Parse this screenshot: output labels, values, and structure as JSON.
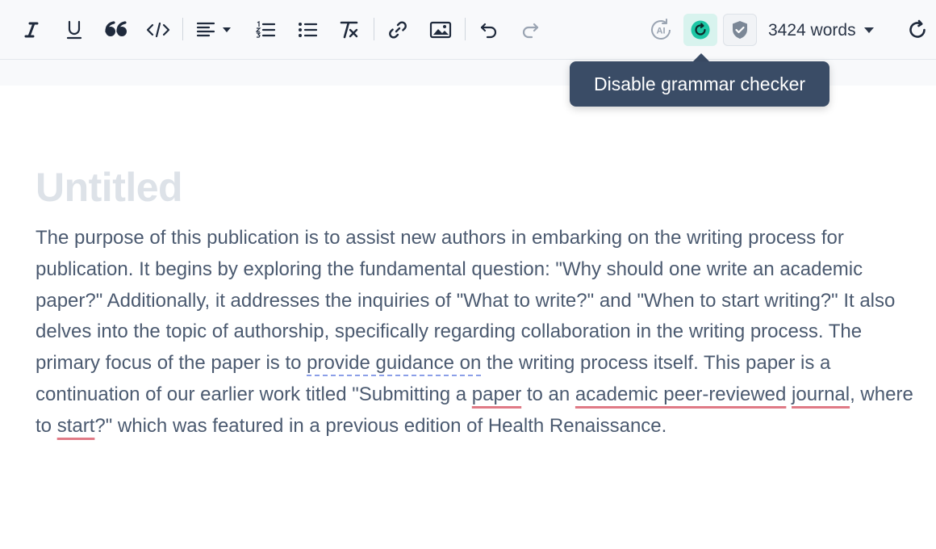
{
  "toolbar": {
    "buttons": [
      {
        "name": "italic",
        "icon": "italic-icon"
      },
      {
        "name": "underline",
        "icon": "underline-icon"
      },
      {
        "name": "blockquote",
        "icon": "quote-icon"
      },
      {
        "name": "code",
        "icon": "code-icon"
      },
      {
        "name": "align",
        "icon": "align-left-icon"
      },
      {
        "name": "ordered-list",
        "icon": "ordered-list-icon"
      },
      {
        "name": "bullet-list",
        "icon": "bullet-list-icon"
      },
      {
        "name": "clear-format",
        "icon": "clear-format-icon"
      },
      {
        "name": "link",
        "icon": "link-icon"
      },
      {
        "name": "image",
        "icon": "image-icon"
      },
      {
        "name": "undo",
        "icon": "undo-icon"
      },
      {
        "name": "redo",
        "icon": "redo-icon"
      },
      {
        "name": "ai",
        "icon": "ai-icon"
      },
      {
        "name": "grammar-checker",
        "icon": "grammar-checker-icon",
        "active": true
      },
      {
        "name": "plagiarism",
        "icon": "shield-check-icon"
      },
      {
        "name": "refresh",
        "icon": "refresh-icon"
      }
    ],
    "word_count": "3424 words",
    "accent_color": "#1cc6a4"
  },
  "tooltip": {
    "text": "Disable grammar checker"
  },
  "document": {
    "title_placeholder": "Untitled",
    "body_segments": [
      {
        "text": "The purpose of this publication is to assist new authors in embarking on the writing process for publication. It begins by exploring the fundamental question: \"Why should one write an academic paper?\" Additionally, it addresses the inquiries of \"What to write?\" and \"When to start writing?\" It also delves into the topic of authorship, specifically regarding collaboration in the writing process. The primary focus of the paper is to "
      },
      {
        "text": "provide guidance on",
        "mark": "style-suggestion"
      },
      {
        "text": " the writing process itself. This paper is a continuation of our earlier work titled \"Submitting a "
      },
      {
        "text": "paper",
        "mark": "grammar-error"
      },
      {
        "text": " to an "
      },
      {
        "text": "academic peer-reviewed",
        "mark": "grammar-error"
      },
      {
        "text": " "
      },
      {
        "text": "journal",
        "mark": "grammar-error"
      },
      {
        "text": ", where to "
      },
      {
        "text": "start",
        "mark": "grammar-error"
      },
      {
        "text": "?\" which was featured in a previous edition of Health Renaissance."
      }
    ]
  }
}
